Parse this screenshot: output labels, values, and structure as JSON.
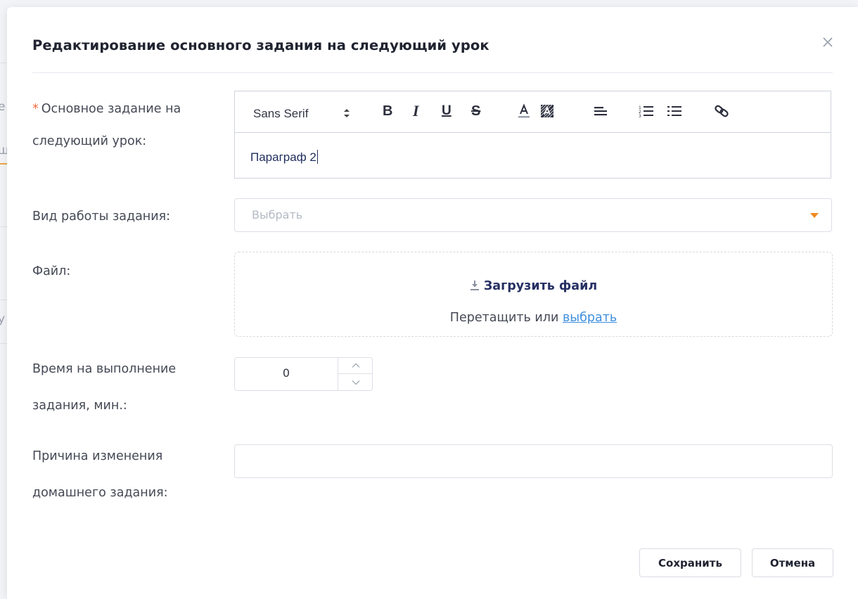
{
  "background": {
    "fragment_1": "е",
    "fragment_2": "щ",
    "fragment_3": "у"
  },
  "modal": {
    "title": "Редактирование основного задания на следующий урок",
    "close_icon": "close-icon"
  },
  "form": {
    "main_task": {
      "required_mark": "*",
      "label_line1": "Основное задание на",
      "label_line2": "следующий урок:",
      "editor": {
        "font_select": "Sans Serif",
        "bold": "B",
        "italic": "I",
        "underline": "U",
        "strike": "S",
        "content": "Параграф 2",
        "toolbar_icons": [
          "font-color-icon",
          "background-color-icon",
          "align-icon",
          "ordered-list-icon",
          "bullet-list-icon",
          "link-icon"
        ]
      }
    },
    "work_type": {
      "label": "Вид работы задания:",
      "placeholder": "Выбрать",
      "accent_color": "#f18a1f"
    },
    "file": {
      "label": "Файл:",
      "upload_text": "Загрузить файл",
      "drag_text": "Перетащить или",
      "choose_link": "выбрать"
    },
    "time": {
      "label_line1": "Время на выполнение",
      "label_line2": "задания, мин.:",
      "value": "0"
    },
    "reason": {
      "label_line1": "Причина изменения",
      "label_line2": "домашнего задания:",
      "value": ""
    }
  },
  "footer": {
    "save_label": "Сохранить",
    "cancel_label": "Отмена"
  },
  "colors": {
    "required": "#f06a3c",
    "link": "#3f8fe0",
    "upload_text": "#263063"
  }
}
